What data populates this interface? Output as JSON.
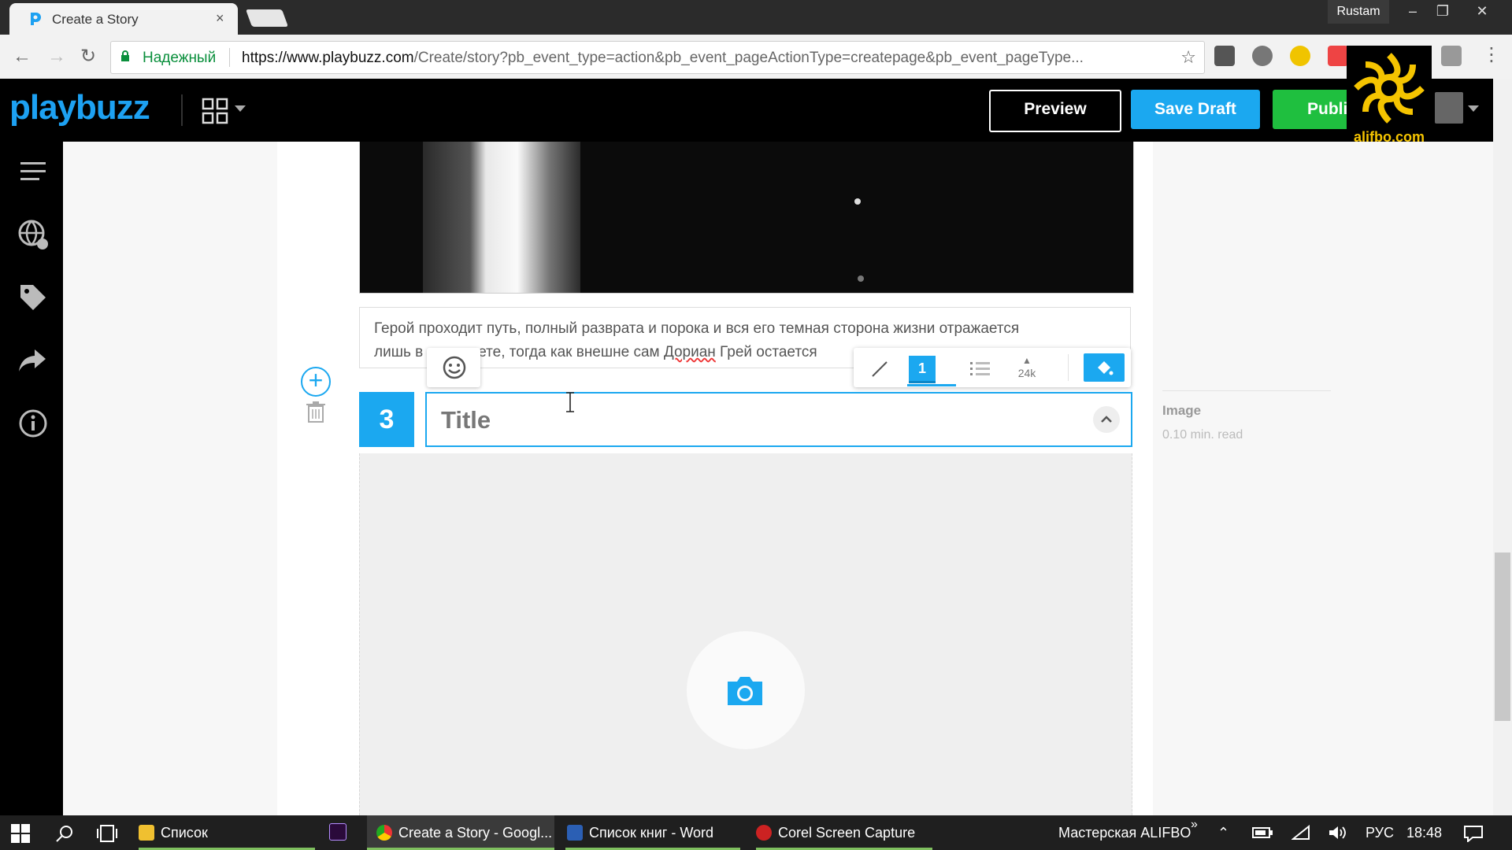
{
  "browser": {
    "tab_title": "Create a Story",
    "tab_close": "×",
    "user_name": "Rustam",
    "secure_label": "Надежный",
    "url_host": "https://www.playbuzz.com",
    "url_path": "/Create/story?pb_event_type=action&pb_event_pageActionType=createpage&pb_event_pageType...",
    "window_controls": [
      "–",
      "❐",
      "✕"
    ]
  },
  "header": {
    "logo": "playbuzz",
    "preview_label": "Preview",
    "save_draft_label": "Save Draft",
    "publish_label": "Publi",
    "watermark": "alifbo.com"
  },
  "content": {
    "paragraph_part1": "Герой проходит путь, полный разврата и порока и вся его темная сторона жизни отражается",
    "paragraph_part2_a": "лишь в",
    "paragraph_part2_b": "ете, тогда как внешне сам ",
    "paragraph_spell": "Дориан",
    "paragraph_part2_c": " Грей остается",
    "toolbar_number": "1",
    "toolbar_count": "24k",
    "item_number": "3",
    "title_placeholder": "Title"
  },
  "right_panel": {
    "label": "Image",
    "read_time": "0.10 min. read"
  },
  "taskbar": {
    "items": [
      {
        "label": "Список"
      },
      {
        "label": "Create a Story - Googl..."
      },
      {
        "label": "Список книг - Word"
      },
      {
        "label": "Corel Screen Capture"
      }
    ],
    "tray_title": "Мастерская ALIFBO",
    "tray_chevron": "»",
    "language": "РУС",
    "time": "18:48"
  },
  "colors": {
    "accent": "#1ba8f0",
    "publish": "#1fbf3f",
    "header_bg": "#000000",
    "watermark": "#f5c400"
  }
}
